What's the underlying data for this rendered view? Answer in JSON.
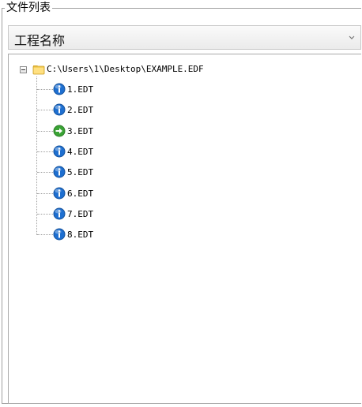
{
  "groupbox": {
    "title": "文件列表"
  },
  "combo": {
    "selected": "工程名称",
    "arrow_icon": "chevron-down-icon"
  },
  "tree": {
    "root": {
      "label": "C:\\Users\\1\\Desktop\\EXAMPLE.EDF",
      "icon": "folder-icon",
      "expanded": true
    },
    "children": [
      {
        "label": "1.EDT",
        "icon": "info-icon"
      },
      {
        "label": "2.EDT",
        "icon": "info-icon"
      },
      {
        "label": "3.EDT",
        "icon": "green-arrow-icon"
      },
      {
        "label": "4.EDT",
        "icon": "info-icon"
      },
      {
        "label": "5.EDT",
        "icon": "info-icon"
      },
      {
        "label": "6.EDT",
        "icon": "info-icon"
      },
      {
        "label": "7.EDT",
        "icon": "info-icon"
      },
      {
        "label": "8.EDT",
        "icon": "info-icon"
      }
    ]
  },
  "colors": {
    "info": "#1e6fd0",
    "active": "#3aa335",
    "folder": "#f2c94c"
  }
}
